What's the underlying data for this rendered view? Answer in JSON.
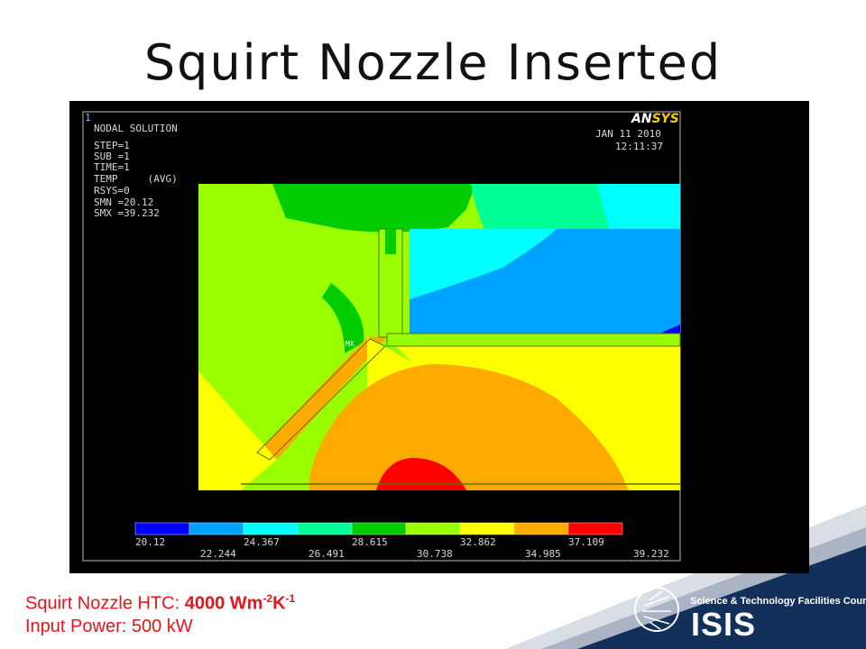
{
  "slide": {
    "title": "Squirt Nozzle Inserted"
  },
  "plot": {
    "window_number": "1",
    "header_lines": [
      "NODAL SOLUTION",
      "STEP=1",
      "SUB =1",
      "TIME=1",
      "TEMP     (AVG)",
      "RSYS=0",
      "SMN =20.12",
      "SMX =39.232"
    ],
    "brand": {
      "prefix": "AN",
      "suffix": "SYS"
    },
    "date": "JAN 11 2010",
    "time": "12:11:37",
    "mx_marker": "MX",
    "legend": {
      "colors": [
        "#0000ff",
        "#00a2ff",
        "#00ffff",
        "#00ff96",
        "#00cc00",
        "#99ff00",
        "#ffff00",
        "#ffaa00",
        "#ff0000"
      ],
      "top_labels": [
        "20.12",
        "24.367",
        "28.615",
        "32.862",
        "37.109"
      ],
      "bottom_labels": [
        "22.244",
        "26.491",
        "30.738",
        "34.985",
        "39.232"
      ]
    }
  },
  "info": {
    "htc_label": "Squirt Nozzle HTC: ",
    "htc_value": "4000 Wm",
    "htc_exp1": "-2",
    "htc_unit": "K",
    "htc_exp2": "-1",
    "power_line": "Input Power: 500 kW"
  },
  "logo": {
    "org": "Science & Technology Facilities Council",
    "name": "ISIS"
  },
  "colors": {
    "navy": "#12305a",
    "accent_red": "#e8141a"
  }
}
